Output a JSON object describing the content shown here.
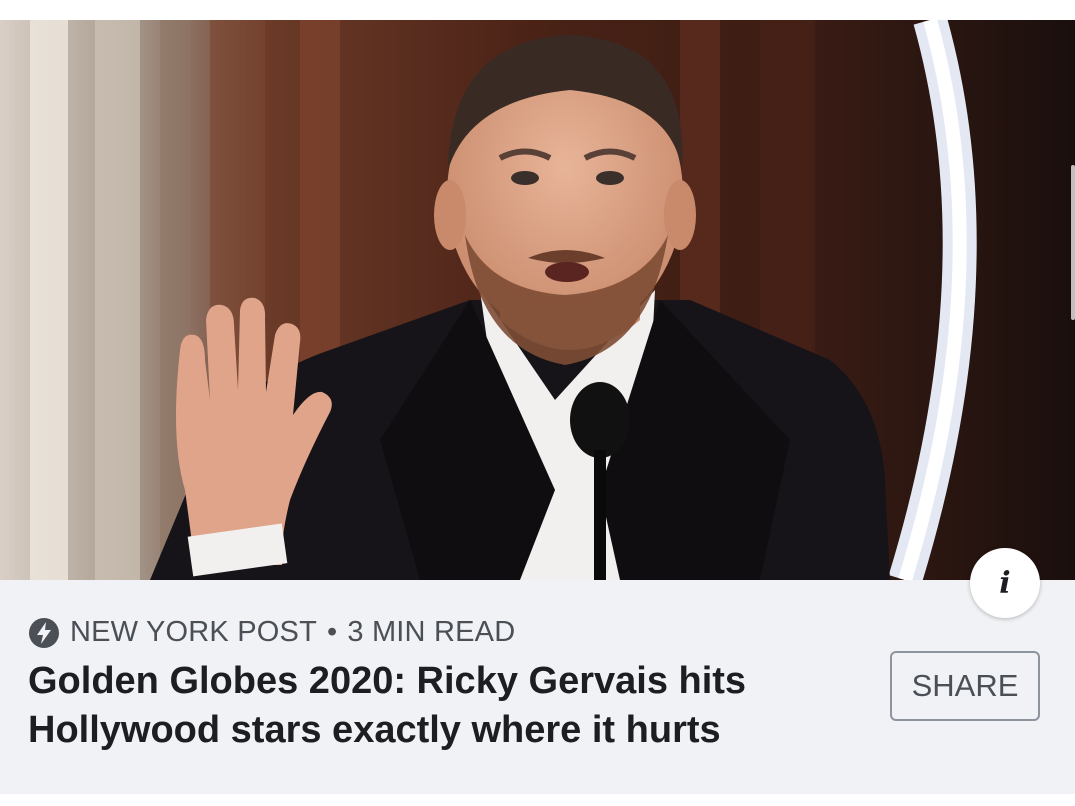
{
  "card": {
    "publisher": "NEW YORK POST",
    "separator": "•",
    "read_time": "3 MIN READ",
    "headline": "Golden Globes 2020: Ricky Gervais hits Hollywood stars exactly where it hurts",
    "share_label": "SHARE",
    "info_label": "i",
    "icons": {
      "publisher": "lightning-bolt-icon",
      "info": "info-icon"
    }
  },
  "colors": {
    "card_background": "#f0f2f5",
    "text_primary": "#1c1e21",
    "text_secondary": "#4b4f56",
    "button_border": "#8d949e"
  }
}
